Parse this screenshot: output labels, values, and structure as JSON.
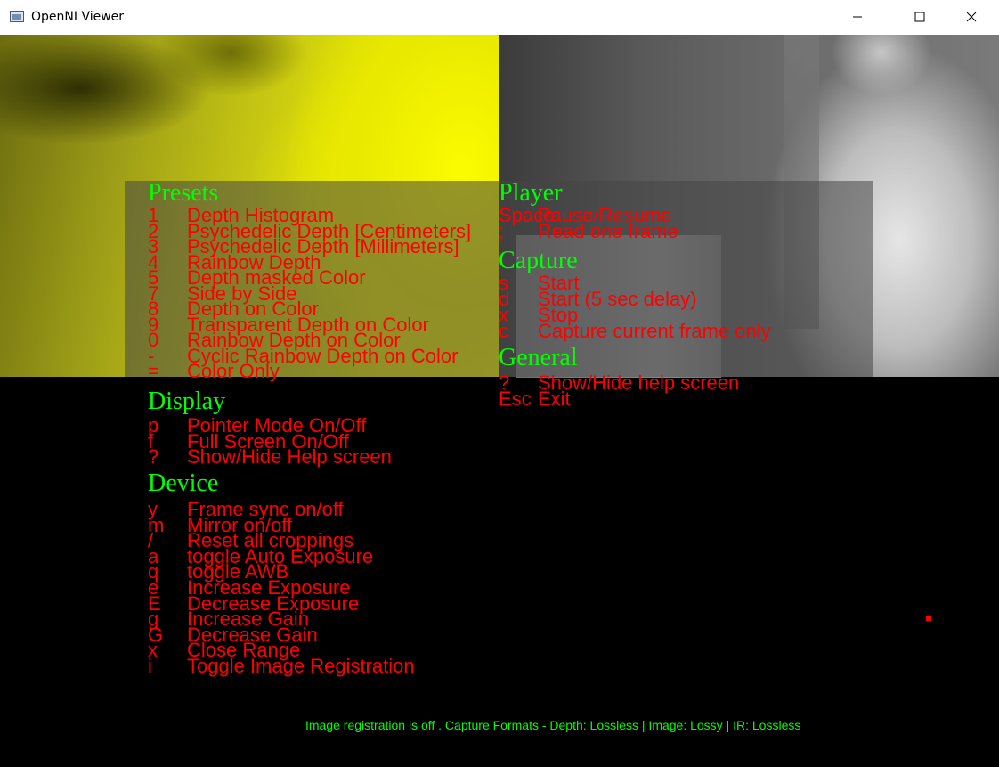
{
  "window": {
    "title": "OpenNI Viewer",
    "minimize_icon": "minimize-icon",
    "maximize_icon": "maximize-icon",
    "close_icon": "close-icon"
  },
  "help": {
    "presets": {
      "heading": "Presets",
      "items": [
        {
          "key": "1",
          "label": "Depth Histogram"
        },
        {
          "key": "2",
          "label": "Psychedelic Depth [Centimeters]"
        },
        {
          "key": "3",
          "label": "Psychedelic Depth [Millimeters]"
        },
        {
          "key": "4",
          "label": "Rainbow Depth"
        },
        {
          "key": "5",
          "label": "Depth masked Color"
        },
        {
          "key": "7",
          "label": "Side by Side"
        },
        {
          "key": "8",
          "label": "Depth on Color"
        },
        {
          "key": "9",
          "label": "Transparent Depth on Color"
        },
        {
          "key": "0",
          "label": "Rainbow Depth on Color"
        },
        {
          "key": "-",
          "label": "Cyclic Rainbow Depth on Color"
        },
        {
          "key": "=",
          "label": "Color Only"
        }
      ]
    },
    "display": {
      "heading": "Display",
      "items": [
        {
          "key": "p",
          "label": "Pointer Mode On/Off"
        },
        {
          "key": "f",
          "label": "Full Screen On/Off"
        },
        {
          "key": "?",
          "label": "Show/Hide Help screen"
        }
      ]
    },
    "device": {
      "heading": "Device",
      "items": [
        {
          "key": "y",
          "label": "Frame sync on/off"
        },
        {
          "key": "m",
          "label": "Mirror on/off"
        },
        {
          "key": "/",
          "label": "Reset all croppings"
        },
        {
          "key": "a",
          "label": "toggle Auto Exposure"
        },
        {
          "key": "q",
          "label": "toggle AWB"
        },
        {
          "key": "e",
          "label": "Increase Exposure"
        },
        {
          "key": "E",
          "label": "Decrease Exposure"
        },
        {
          "key": "g",
          "label": "Increase Gain"
        },
        {
          "key": "G",
          "label": "Decrease Gain"
        },
        {
          "key": "x",
          "label": "Close Range"
        },
        {
          "key": "i",
          "label": "Toggle Image Registration"
        }
      ]
    },
    "player": {
      "heading": "Player",
      "items": [
        {
          "key": "Space",
          "label": "Pause/Resume"
        },
        {
          "key": ";",
          "label": "Read one frame"
        }
      ]
    },
    "capture": {
      "heading": "Capture",
      "items": [
        {
          "key": "s",
          "label": "Start"
        },
        {
          "key": "d",
          "label": "Start (5 sec delay)"
        },
        {
          "key": "x",
          "label": "Stop"
        },
        {
          "key": "c",
          "label": "Capture current frame only"
        }
      ]
    },
    "general": {
      "heading": "General",
      "items": [
        {
          "key": "?",
          "label": "Show/Hide help screen"
        },
        {
          "key": "Esc",
          "label": "Exit"
        }
      ]
    }
  },
  "status_bar": "Image registration is off . Capture Formats - Depth: Lossless | Image: Lossy | IR: Lossless",
  "colors": {
    "heading": "#00ff00",
    "hotkey": "#ff0000",
    "depth_view": "#e8e800",
    "background": "#000000"
  }
}
